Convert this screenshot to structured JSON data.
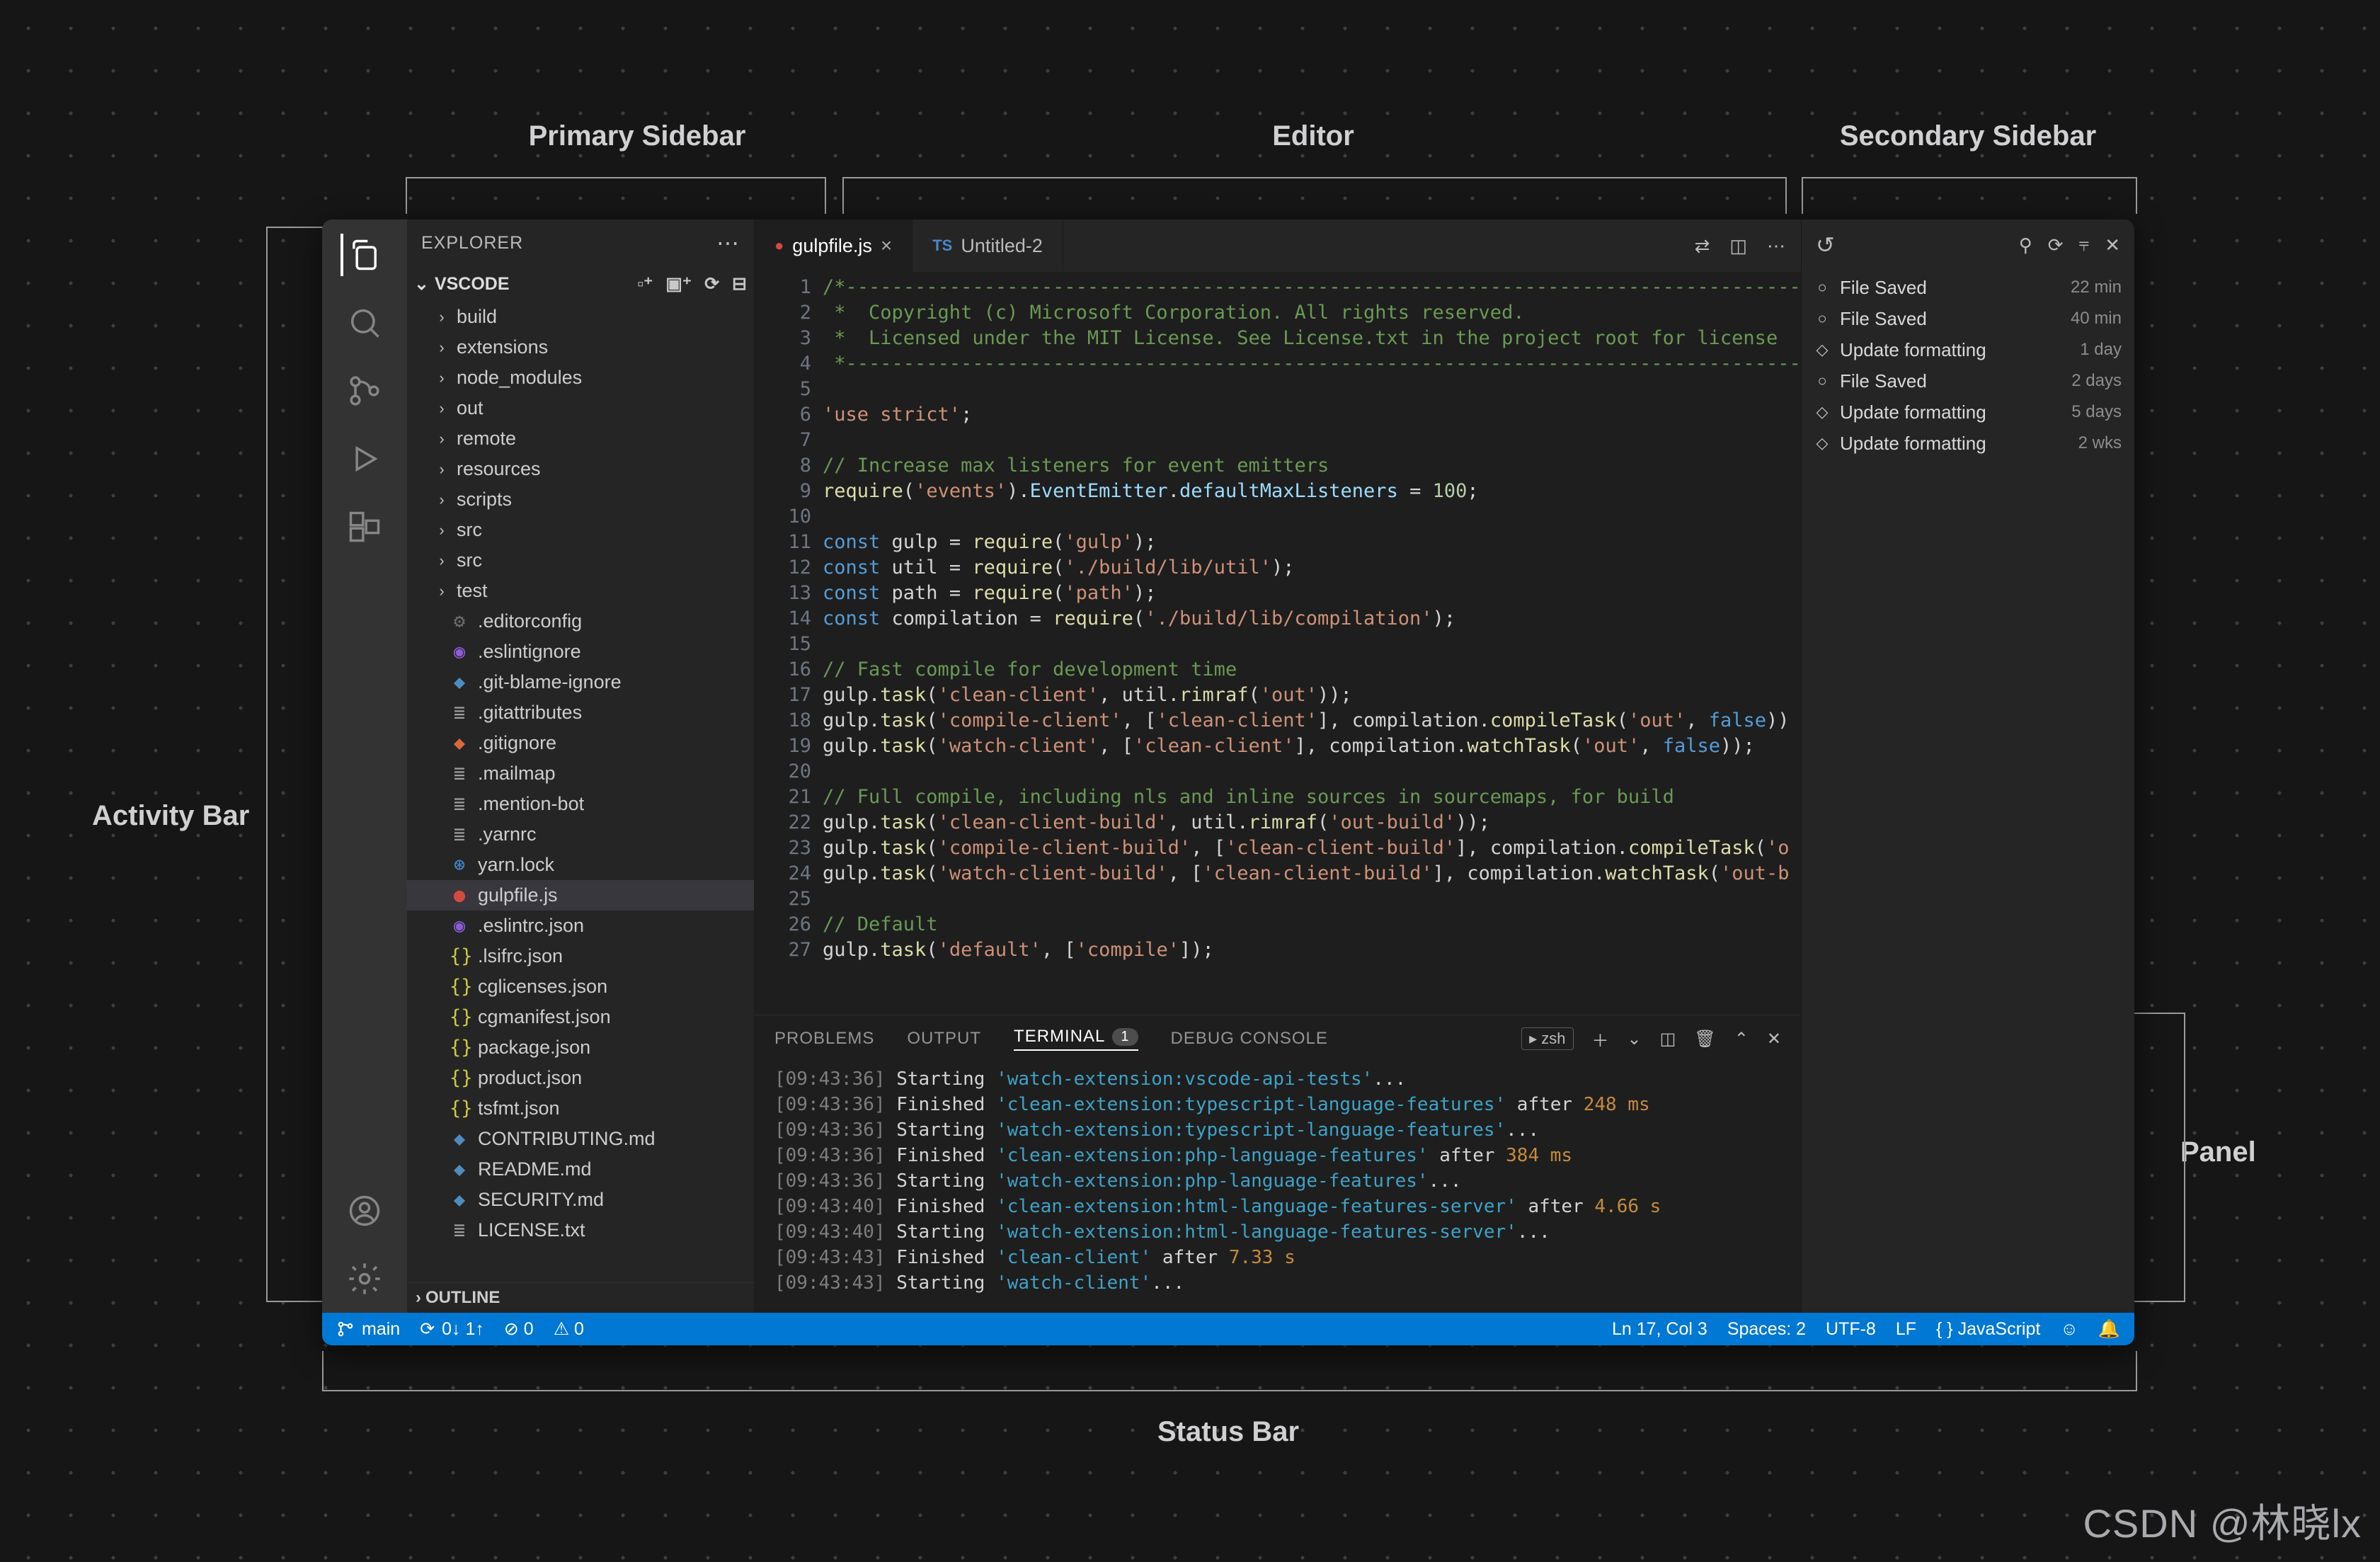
{
  "labels": {
    "primary_sidebar": "Primary Sidebar",
    "editor": "Editor",
    "secondary_sidebar": "Secondary Sidebar",
    "activity_bar": "Activity Bar",
    "panel": "Panel",
    "status_bar": "Status Bar",
    "watermark": "CSDN @林晓lx"
  },
  "explorer": {
    "title": "EXPLORER",
    "project": "VSCODE",
    "folders": [
      "build",
      "extensions",
      "node_modules",
      "out",
      "remote",
      "resources",
      "scripts",
      "src",
      "src",
      "test"
    ],
    "files": [
      {
        "icon": "⚙",
        "color": "#6d6d6d",
        "name": ".editorconfig"
      },
      {
        "icon": "◉",
        "color": "#8f5bd7",
        "name": ".eslintignore"
      },
      {
        "icon": "◆",
        "color": "#4f8cbe",
        "name": ".git-blame-ignore"
      },
      {
        "icon": "≣",
        "color": "#9e9e9e",
        "name": ".gitattributes"
      },
      {
        "icon": "◆",
        "color": "#d86a3a",
        "name": ".gitignore"
      },
      {
        "icon": "≣",
        "color": "#9e9e9e",
        "name": ".mailmap"
      },
      {
        "icon": "≣",
        "color": "#9e9e9e",
        "name": ".mention-bot"
      },
      {
        "icon": "≣",
        "color": "#9e9e9e",
        "name": ".yarnrc"
      },
      {
        "icon": "⊛",
        "color": "#4183c4",
        "name": "yarn.lock"
      },
      {
        "icon": "●",
        "color": "#d34b3f",
        "name": "gulpfile.js",
        "selected": true
      },
      {
        "icon": "◉",
        "color": "#8f5bd7",
        "name": ".eslintrc.json"
      },
      {
        "icon": "{}",
        "color": "#cbcb41",
        "name": ".lsifrc.json"
      },
      {
        "icon": "{}",
        "color": "#cbcb41",
        "name": "cglicenses.json"
      },
      {
        "icon": "{}",
        "color": "#cbcb41",
        "name": "cgmanifest.json"
      },
      {
        "icon": "{}",
        "color": "#cbcb41",
        "name": "package.json"
      },
      {
        "icon": "{}",
        "color": "#cbcb41",
        "name": "product.json"
      },
      {
        "icon": "{}",
        "color": "#cbcb41",
        "name": "tsfmt.json"
      },
      {
        "icon": "◆",
        "color": "#4f8cbe",
        "name": "CONTRIBUTING.md"
      },
      {
        "icon": "◆",
        "color": "#4f8cbe",
        "name": "README.md"
      },
      {
        "icon": "◆",
        "color": "#4f8cbe",
        "name": "SECURITY.md"
      },
      {
        "icon": "≣",
        "color": "#9e9e9e",
        "name": "LICENSE.txt"
      }
    ],
    "outline": "OUTLINE"
  },
  "tabs": [
    {
      "icon": "●",
      "icon_color": "#d34b3f",
      "label": "gulpfile.js",
      "active": true,
      "closable": true
    },
    {
      "icon": "TS",
      "icon_color": "#4a87c4",
      "label": "Untitled-2",
      "active": false,
      "closable": false
    }
  ],
  "editor": {
    "lines": [
      {
        "html": "<span class='c-cm'>/*----------------------------------------------------------------------------------------</span>"
      },
      {
        "html": "<span class='c-cm'> *  Copyright (c) Microsoft Corporation. All rights reserved.</span>"
      },
      {
        "html": "<span class='c-cm'> *  Licensed under the MIT License. See License.txt in the project root for license </span>"
      },
      {
        "html": "<span class='c-cm'> *--------------------------------------------------------------------------------------</span>"
      },
      {
        "html": ""
      },
      {
        "html": "<span class='c-st'>'use strict'</span><span class='c-pl'>;</span>"
      },
      {
        "html": ""
      },
      {
        "html": "<span class='c-cm'>// Increase max listeners for event emitters</span>"
      },
      {
        "html": "<span class='c-fn'>require</span><span class='c-pl'>(</span><span class='c-st'>'events'</span><span class='c-pl'>).</span><span class='c-pr'>EventEmitter</span><span class='c-pl'>.</span><span class='c-pr'>defaultMaxListeners</span><span class='c-pl'> = </span><span class='c-nm'>100</span><span class='c-pl'>;</span>"
      },
      {
        "html": ""
      },
      {
        "html": "<span class='c-kw'>const</span><span class='c-pl'> gulp = </span><span class='c-fn'>require</span><span class='c-pl'>(</span><span class='c-st'>'gulp'</span><span class='c-pl'>);</span>"
      },
      {
        "html": "<span class='c-kw'>const</span><span class='c-pl'> util = </span><span class='c-fn'>require</span><span class='c-pl'>(</span><span class='c-st'>'./build/lib/util'</span><span class='c-pl'>);</span>"
      },
      {
        "html": "<span class='c-kw'>const</span><span class='c-pl'> path = </span><span class='c-fn'>require</span><span class='c-pl'>(</span><span class='c-st'>'path'</span><span class='c-pl'>);</span>"
      },
      {
        "html": "<span class='c-kw'>const</span><span class='c-pl'> compilation = </span><span class='c-fn'>require</span><span class='c-pl'>(</span><span class='c-st'>'./build/lib/compilation'</span><span class='c-pl'>);</span>"
      },
      {
        "html": ""
      },
      {
        "html": "<span class='c-cm'>// Fast compile for development time</span>"
      },
      {
        "html": "<span class='c-pl'>gulp.</span><span class='c-fn'>task</span><span class='c-pl'>(</span><span class='c-st'>'clean-client'</span><span class='c-pl'>, util.</span><span class='c-fn'>rimraf</span><span class='c-pl'>(</span><span class='c-st'>'out'</span><span class='c-pl'>));</span>"
      },
      {
        "html": "<span class='c-pl'>gulp.</span><span class='c-fn'>task</span><span class='c-pl'>(</span><span class='c-st'>'compile-client'</span><span class='c-pl'>, [</span><span class='c-st'>'clean-client'</span><span class='c-pl'>], compilation.</span><span class='c-fn'>compileTask</span><span class='c-pl'>(</span><span class='c-st'>'out'</span><span class='c-pl'>, </span><span class='c-kw'>false</span><span class='c-pl'>))</span>"
      },
      {
        "html": "<span class='c-pl'>gulp.</span><span class='c-fn'>task</span><span class='c-pl'>(</span><span class='c-st'>'watch-client'</span><span class='c-pl'>, [</span><span class='c-st'>'clean-client'</span><span class='c-pl'>], compilation.</span><span class='c-fn'>watchTask</span><span class='c-pl'>(</span><span class='c-st'>'out'</span><span class='c-pl'>, </span><span class='c-kw'>false</span><span class='c-pl'>));</span>"
      },
      {
        "html": ""
      },
      {
        "html": "<span class='c-cm'>// Full compile, including nls and inline sources in sourcemaps, for build</span>"
      },
      {
        "html": "<span class='c-pl'>gulp.</span><span class='c-fn'>task</span><span class='c-pl'>(</span><span class='c-st'>'clean-client-build'</span><span class='c-pl'>, util.</span><span class='c-fn'>rimraf</span><span class='c-pl'>(</span><span class='c-st'>'out-build'</span><span class='c-pl'>));</span>"
      },
      {
        "html": "<span class='c-pl'>gulp.</span><span class='c-fn'>task</span><span class='c-pl'>(</span><span class='c-st'>'compile-client-build'</span><span class='c-pl'>, [</span><span class='c-st'>'clean-client-build'</span><span class='c-pl'>], compilation.</span><span class='c-fn'>compileTask</span><span class='c-pl'>(</span><span class='c-st'>'o</span>"
      },
      {
        "html": "<span class='c-pl'>gulp.</span><span class='c-fn'>task</span><span class='c-pl'>(</span><span class='c-st'>'watch-client-build'</span><span class='c-pl'>, [</span><span class='c-st'>'clean-client-build'</span><span class='c-pl'>], compilation.</span><span class='c-fn'>watchTask</span><span class='c-pl'>(</span><span class='c-st'>'out-b</span>"
      },
      {
        "html": ""
      },
      {
        "html": "<span class='c-cm'>// Default</span>"
      },
      {
        "html": "<span class='c-pl'>gulp.</span><span class='c-fn'>task</span><span class='c-pl'>(</span><span class='c-st'>'default'</span><span class='c-pl'>, [</span><span class='c-st'>'compile'</span><span class='c-pl'>]);</span>"
      }
    ]
  },
  "panel": {
    "tabs": [
      {
        "label": "PROBLEMS"
      },
      {
        "label": "OUTPUT"
      },
      {
        "label": "TERMINAL",
        "active": true,
        "badge": "1"
      },
      {
        "label": "DEBUG CONSOLE"
      }
    ],
    "shell_label": "zsh",
    "lines": [
      {
        "ts": "[09:43:36]",
        "act": "Starting",
        "name": "'watch-extension:vscode-api-tests'",
        "suffix": "..."
      },
      {
        "ts": "[09:43:36]",
        "act": "Finished",
        "name": "'clean-extension:typescript-language-features'",
        "after": " after ",
        "dur": "248 ms"
      },
      {
        "ts": "[09:43:36]",
        "act": "Starting",
        "name": "'watch-extension:typescript-language-features'",
        "suffix": "..."
      },
      {
        "ts": "[09:43:36]",
        "act": "Finished",
        "name": "'clean-extension:php-language-features'",
        "after": " after ",
        "dur": "384 ms"
      },
      {
        "ts": "[09:43:36]",
        "act": "Starting",
        "name": "'watch-extension:php-language-features'",
        "suffix": "..."
      },
      {
        "ts": "[09:43:40]",
        "act": "Finished",
        "name": "'clean-extension:html-language-features-server'",
        "after": " after ",
        "dur": "4.66 s"
      },
      {
        "ts": "[09:43:40]",
        "act": "Starting",
        "name": "'watch-extension:html-language-features-server'",
        "suffix": "..."
      },
      {
        "ts": "[09:43:43]",
        "act": "Finished",
        "name": "'clean-client'",
        "after": " after ",
        "dur": "7.33 s"
      },
      {
        "ts": "[09:43:43]",
        "act": "Starting",
        "name": "'watch-client'",
        "suffix": "..."
      }
    ]
  },
  "timeline": [
    {
      "glyph": "○",
      "label": "File Saved",
      "time": "22 min"
    },
    {
      "glyph": "○",
      "label": "File Saved",
      "time": "40 min"
    },
    {
      "glyph": "◇",
      "label": "Update formatting",
      "time": "1 day"
    },
    {
      "glyph": "○",
      "label": "File Saved",
      "time": "2 days"
    },
    {
      "glyph": "◇",
      "label": "Update formatting",
      "time": "5 days"
    },
    {
      "glyph": "◇",
      "label": "Update formatting",
      "time": "2 wks"
    }
  ],
  "status": {
    "branch": "main",
    "sync": "0↓ 1↑",
    "errors": "⊘ 0",
    "warnings": "⚠ 0",
    "cursor": "Ln 17, Col 3",
    "spaces": "Spaces: 2",
    "encoding": "UTF-8",
    "eol": "LF",
    "lang": "{ }  JavaScript"
  }
}
